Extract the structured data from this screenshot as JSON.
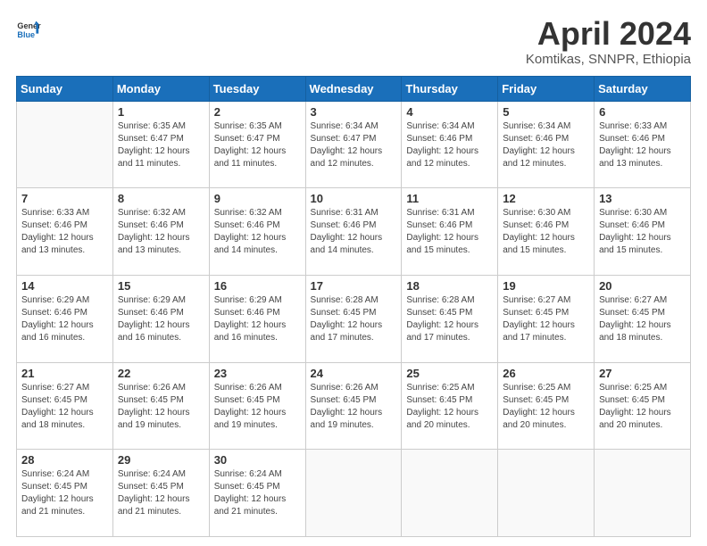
{
  "header": {
    "logo_line1": "General",
    "logo_line2": "Blue",
    "month": "April 2024",
    "location": "Komtikas, SNNPR, Ethiopia"
  },
  "days_of_week": [
    "Sunday",
    "Monday",
    "Tuesday",
    "Wednesday",
    "Thursday",
    "Friday",
    "Saturday"
  ],
  "weeks": [
    [
      {
        "day": "",
        "info": ""
      },
      {
        "day": "1",
        "info": "Sunrise: 6:35 AM\nSunset: 6:47 PM\nDaylight: 12 hours\nand 11 minutes."
      },
      {
        "day": "2",
        "info": "Sunrise: 6:35 AM\nSunset: 6:47 PM\nDaylight: 12 hours\nand 11 minutes."
      },
      {
        "day": "3",
        "info": "Sunrise: 6:34 AM\nSunset: 6:47 PM\nDaylight: 12 hours\nand 12 minutes."
      },
      {
        "day": "4",
        "info": "Sunrise: 6:34 AM\nSunset: 6:46 PM\nDaylight: 12 hours\nand 12 minutes."
      },
      {
        "day": "5",
        "info": "Sunrise: 6:34 AM\nSunset: 6:46 PM\nDaylight: 12 hours\nand 12 minutes."
      },
      {
        "day": "6",
        "info": "Sunrise: 6:33 AM\nSunset: 6:46 PM\nDaylight: 12 hours\nand 13 minutes."
      }
    ],
    [
      {
        "day": "7",
        "info": "Sunrise: 6:33 AM\nSunset: 6:46 PM\nDaylight: 12 hours\nand 13 minutes."
      },
      {
        "day": "8",
        "info": "Sunrise: 6:32 AM\nSunset: 6:46 PM\nDaylight: 12 hours\nand 13 minutes."
      },
      {
        "day": "9",
        "info": "Sunrise: 6:32 AM\nSunset: 6:46 PM\nDaylight: 12 hours\nand 14 minutes."
      },
      {
        "day": "10",
        "info": "Sunrise: 6:31 AM\nSunset: 6:46 PM\nDaylight: 12 hours\nand 14 minutes."
      },
      {
        "day": "11",
        "info": "Sunrise: 6:31 AM\nSunset: 6:46 PM\nDaylight: 12 hours\nand 15 minutes."
      },
      {
        "day": "12",
        "info": "Sunrise: 6:30 AM\nSunset: 6:46 PM\nDaylight: 12 hours\nand 15 minutes."
      },
      {
        "day": "13",
        "info": "Sunrise: 6:30 AM\nSunset: 6:46 PM\nDaylight: 12 hours\nand 15 minutes."
      }
    ],
    [
      {
        "day": "14",
        "info": "Sunrise: 6:29 AM\nSunset: 6:46 PM\nDaylight: 12 hours\nand 16 minutes."
      },
      {
        "day": "15",
        "info": "Sunrise: 6:29 AM\nSunset: 6:46 PM\nDaylight: 12 hours\nand 16 minutes."
      },
      {
        "day": "16",
        "info": "Sunrise: 6:29 AM\nSunset: 6:46 PM\nDaylight: 12 hours\nand 16 minutes."
      },
      {
        "day": "17",
        "info": "Sunrise: 6:28 AM\nSunset: 6:45 PM\nDaylight: 12 hours\nand 17 minutes."
      },
      {
        "day": "18",
        "info": "Sunrise: 6:28 AM\nSunset: 6:45 PM\nDaylight: 12 hours\nand 17 minutes."
      },
      {
        "day": "19",
        "info": "Sunrise: 6:27 AM\nSunset: 6:45 PM\nDaylight: 12 hours\nand 17 minutes."
      },
      {
        "day": "20",
        "info": "Sunrise: 6:27 AM\nSunset: 6:45 PM\nDaylight: 12 hours\nand 18 minutes."
      }
    ],
    [
      {
        "day": "21",
        "info": "Sunrise: 6:27 AM\nSunset: 6:45 PM\nDaylight: 12 hours\nand 18 minutes."
      },
      {
        "day": "22",
        "info": "Sunrise: 6:26 AM\nSunset: 6:45 PM\nDaylight: 12 hours\nand 19 minutes."
      },
      {
        "day": "23",
        "info": "Sunrise: 6:26 AM\nSunset: 6:45 PM\nDaylight: 12 hours\nand 19 minutes."
      },
      {
        "day": "24",
        "info": "Sunrise: 6:26 AM\nSunset: 6:45 PM\nDaylight: 12 hours\nand 19 minutes."
      },
      {
        "day": "25",
        "info": "Sunrise: 6:25 AM\nSunset: 6:45 PM\nDaylight: 12 hours\nand 20 minutes."
      },
      {
        "day": "26",
        "info": "Sunrise: 6:25 AM\nSunset: 6:45 PM\nDaylight: 12 hours\nand 20 minutes."
      },
      {
        "day": "27",
        "info": "Sunrise: 6:25 AM\nSunset: 6:45 PM\nDaylight: 12 hours\nand 20 minutes."
      }
    ],
    [
      {
        "day": "28",
        "info": "Sunrise: 6:24 AM\nSunset: 6:45 PM\nDaylight: 12 hours\nand 21 minutes."
      },
      {
        "day": "29",
        "info": "Sunrise: 6:24 AM\nSunset: 6:45 PM\nDaylight: 12 hours\nand 21 minutes."
      },
      {
        "day": "30",
        "info": "Sunrise: 6:24 AM\nSunset: 6:45 PM\nDaylight: 12 hours\nand 21 minutes."
      },
      {
        "day": "",
        "info": ""
      },
      {
        "day": "",
        "info": ""
      },
      {
        "day": "",
        "info": ""
      },
      {
        "day": "",
        "info": ""
      }
    ]
  ]
}
